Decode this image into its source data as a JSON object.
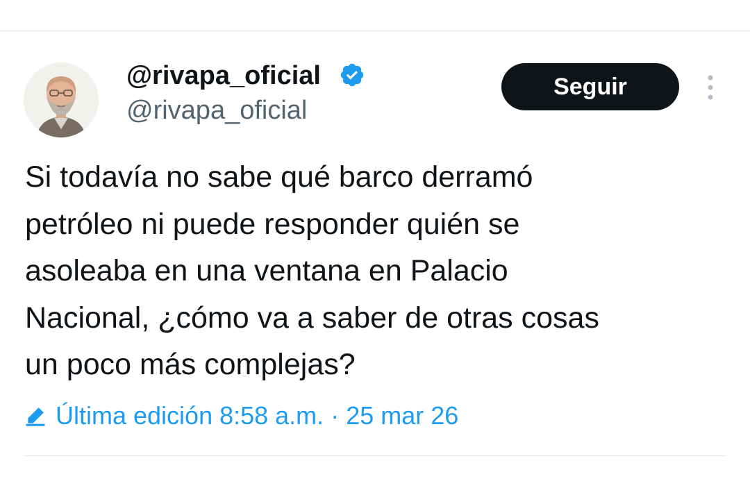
{
  "author": {
    "display_name": "@rivapa_oficial",
    "handle": "@rivapa_oficial",
    "verified_icon": "verified-badge-icon",
    "avatar_icon": "profile-photo"
  },
  "actions": {
    "follow_label": "Seguir",
    "more_icon": "vertical-ellipsis-icon"
  },
  "tweet": {
    "text": "Si todavía no sabe qué barco derramó\npetróleo ni puede responder quién se\nasoleaba en una ventana  en Palacio\nNacional, ¿cómo va a saber de otras cosas\nun poco más complejas?"
  },
  "edit_info": {
    "label": "Última edición 8:58 a.m.",
    "separator": "·",
    "date": "25 mar 26",
    "icon": "pencil-edit-icon"
  },
  "colors": {
    "text": "#0f1419",
    "secondary": "#536471",
    "accent": "#1d9bf0",
    "button_bg": "#0f1419",
    "divider": "#e6e9eb"
  }
}
